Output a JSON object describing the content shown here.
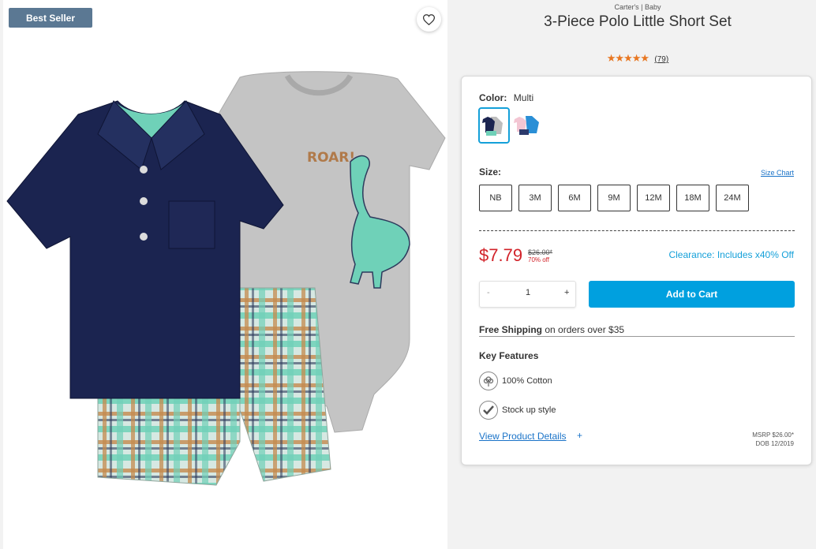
{
  "badge": "Best Seller",
  "brand": "Carter's | Baby",
  "title": "3-Piece Polo Little Short Set",
  "rating": {
    "stars": "★★★★★",
    "count": "(79)"
  },
  "color": {
    "label": "Color:",
    "value": "Multi"
  },
  "size": {
    "label": "Size:",
    "chart_link": "Size Chart",
    "options": [
      "NB",
      "3M",
      "6M",
      "9M",
      "12M",
      "18M",
      "24M"
    ]
  },
  "price": {
    "current": "$7.79",
    "original": "$26.00*",
    "discount": "70% off",
    "clearance": "Clearance: Includes x40% Off"
  },
  "quantity": {
    "minus": "-",
    "value": "1",
    "plus": "+"
  },
  "add_to_cart": "Add to Cart",
  "shipping": {
    "bold": "Free Shipping",
    "rest": " on orders over $35"
  },
  "key_features": {
    "title": "Key Features",
    "items": [
      {
        "icon": "cotton-icon",
        "text": "100% Cotton"
      },
      {
        "icon": "checkmark-icon",
        "text": "Stock up style"
      }
    ]
  },
  "details_link": "View Product Details",
  "details_plus": "+",
  "msrp": "MSRP $26.00*",
  "dob": "DOB 12/2019",
  "colors": {
    "accent": "#00a0df",
    "price_red": "#d2232a",
    "star": "#e87722",
    "badge_bg": "#5b7893",
    "link": "#1a73c8"
  }
}
